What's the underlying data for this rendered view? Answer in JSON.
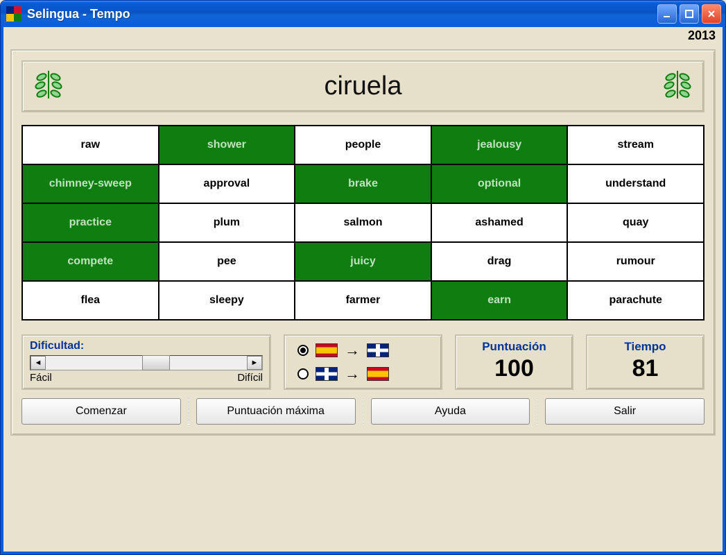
{
  "window": {
    "title": "Selingua - Tempo"
  },
  "year": "2013",
  "prompt_word": "ciruela",
  "grid": [
    [
      {
        "word": "raw",
        "green": false
      },
      {
        "word": "shower",
        "green": true
      },
      {
        "word": "people",
        "green": false
      },
      {
        "word": "jealousy",
        "green": true
      },
      {
        "word": "stream",
        "green": false
      }
    ],
    [
      {
        "word": "chimney-sweep",
        "green": true
      },
      {
        "word": "approval",
        "green": false
      },
      {
        "word": "brake",
        "green": true
      },
      {
        "word": "optional",
        "green": true
      },
      {
        "word": "understand",
        "green": false
      }
    ],
    [
      {
        "word": "practice",
        "green": true
      },
      {
        "word": "plum",
        "green": false
      },
      {
        "word": "salmon",
        "green": false
      },
      {
        "word": "ashamed",
        "green": false
      },
      {
        "word": "quay",
        "green": false
      }
    ],
    [
      {
        "word": "compete",
        "green": true
      },
      {
        "word": "pee",
        "green": false
      },
      {
        "word": "juicy",
        "green": true
      },
      {
        "word": "drag",
        "green": false
      },
      {
        "word": "rumour",
        "green": false
      }
    ],
    [
      {
        "word": "flea",
        "green": false
      },
      {
        "word": "sleepy",
        "green": false
      },
      {
        "word": "farmer",
        "green": false
      },
      {
        "word": "earn",
        "green": true
      },
      {
        "word": "parachute",
        "green": false
      }
    ]
  ],
  "difficulty": {
    "label": "Dificultad:",
    "easy": "Fácil",
    "hard": "Difícil"
  },
  "direction": {
    "selected": 0
  },
  "score": {
    "label": "Puntuación",
    "value": "100"
  },
  "time": {
    "label": "Tiempo",
    "value": "81"
  },
  "buttons": {
    "start": "Comenzar",
    "highscore": "Puntuación máxima",
    "help": "Ayuda",
    "exit": "Salir"
  }
}
